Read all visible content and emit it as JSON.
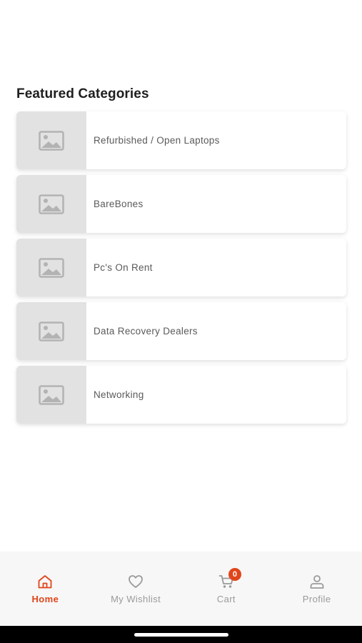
{
  "section": {
    "title": "Featured Categories"
  },
  "categories": [
    {
      "label": "Refurbished / Open Laptops",
      "icon": "image-placeholder-icon"
    },
    {
      "label": "BareBones",
      "icon": "image-placeholder-icon"
    },
    {
      "label": "Pc's On Rent",
      "icon": "image-placeholder-icon"
    },
    {
      "label": "Data Recovery Dealers",
      "icon": "image-placeholder-icon"
    },
    {
      "label": "Networking",
      "icon": "image-placeholder-icon"
    }
  ],
  "bottom_nav": {
    "items": [
      {
        "label": "Home",
        "icon": "home-icon",
        "active": true
      },
      {
        "label": "My Wishlist",
        "icon": "heart-icon",
        "active": false
      },
      {
        "label": "Cart",
        "icon": "cart-icon",
        "active": false,
        "badge": "0"
      },
      {
        "label": "Profile",
        "icon": "user-icon",
        "active": false
      }
    ]
  },
  "colors": {
    "accent": "#e0451b",
    "inactive": "#9a9a9a",
    "thumb_bg": "#e2e2e2"
  }
}
